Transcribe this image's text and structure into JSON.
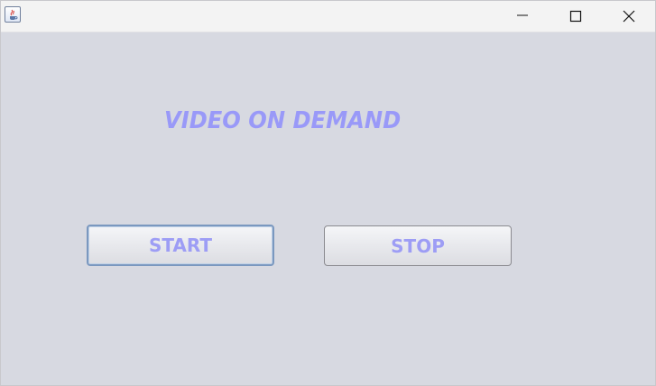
{
  "window": {
    "icon": "java-icon",
    "controls": {
      "minimize_icon": "minimize-icon",
      "maximize_icon": "maximize-icon",
      "close_icon": "close-icon"
    }
  },
  "main": {
    "heading": "VIDEO ON DEMAND",
    "heading_color": "#9999f8",
    "start_label": "START",
    "stop_label": "STOP",
    "button_text_color": "#9d9df5",
    "background_color": "#d7d9e1"
  }
}
